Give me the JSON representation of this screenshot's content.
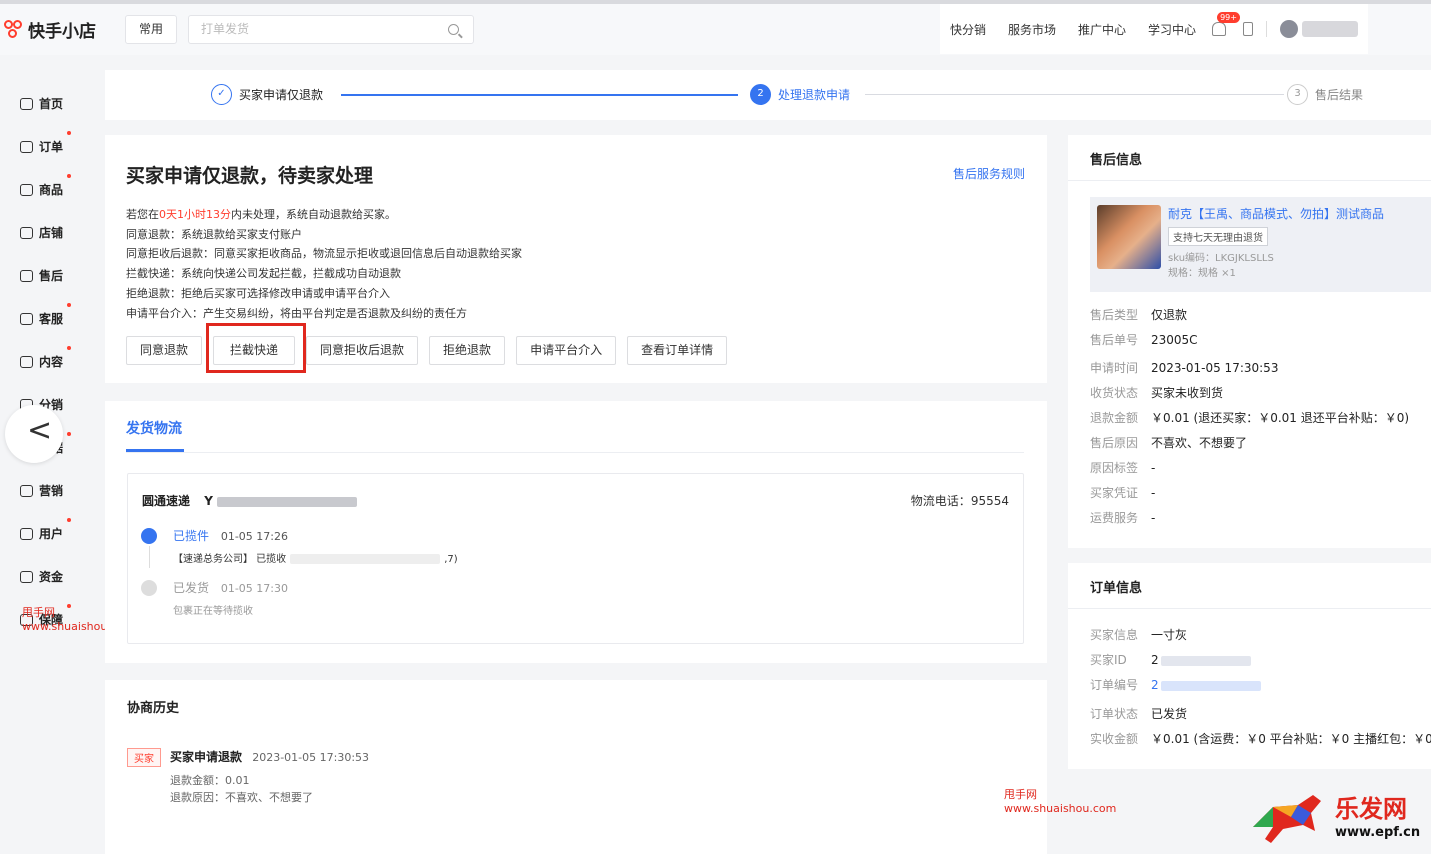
{
  "header": {
    "brand": "快手小店",
    "common_label": "常用",
    "search_placeholder": "打单发货",
    "nav": [
      "快分销",
      "服务市场",
      "推广中心",
      "学习中心"
    ],
    "notify_badge": "99+"
  },
  "sidebar": {
    "items": [
      {
        "label": "首页",
        "icon": "home-icon",
        "dot": false
      },
      {
        "label": "订单",
        "icon": "order-icon",
        "dot": true
      },
      {
        "label": "商品",
        "icon": "goods-icon",
        "dot": true
      },
      {
        "label": "店铺",
        "icon": "shop-icon",
        "dot": false
      },
      {
        "label": "售后",
        "icon": "aftersale-icon",
        "dot": false
      },
      {
        "label": "客服",
        "icon": "service-icon",
        "dot": true
      },
      {
        "label": "内容",
        "icon": "content-icon",
        "dot": true
      },
      {
        "label": "分销",
        "icon": "distribution-icon",
        "dot": false
      },
      {
        "label": "数据",
        "icon": "data-icon",
        "dot": true
      },
      {
        "label": "营销",
        "icon": "marketing-icon",
        "dot": false
      },
      {
        "label": "用户",
        "icon": "user-icon",
        "dot": true
      },
      {
        "label": "资金",
        "icon": "funds-icon",
        "dot": false
      },
      {
        "label": "保障",
        "icon": "shield-icon",
        "dot": true
      }
    ],
    "collapse_glyph": "<"
  },
  "watermark": {
    "name": "甩手网",
    "url": "www.shuaishou.com"
  },
  "steps": {
    "s1": "买家申请仅退款",
    "s2_num": "2",
    "s2": "处理退款申请",
    "s3_num": "3",
    "s3": "售后结果"
  },
  "main": {
    "title": "买家申请仅退款，待卖家处理",
    "rule_link": "售后服务规则",
    "countdown_prefix": "若您在",
    "countdown": "0天1小时13分",
    "countdown_suffix": "内未处理，系统自动退款给买家。",
    "lines": [
      "同意退款：系统退款给买家支付账户",
      "同意拒收后退款：同意买家拒收商品，物流显示拒收或退回信息后自动退款给买家",
      "拦截快递：系统向快递公司发起拦截，拦截成功自动退款",
      "拒绝退款：拒绝后买家可选择修改申请或申请平台介入",
      "申请平台介入：产生交易纠纷，将由平台判定是否退款及纠纷的责任方"
    ],
    "buttons": [
      "同意退款",
      "拦截快递",
      "同意拒收后退款",
      "拒绝退款",
      "申请平台介入",
      "查看订单详情"
    ]
  },
  "shipping": {
    "tab": "发货物流",
    "carrier": "圆通速递",
    "tracking_prefix": "Y",
    "phone_label": "物流电话：",
    "phone": "95554",
    "events": [
      {
        "status": "已揽件",
        "time": "01-05 17:26",
        "detail": "【速递总务公司】 已揽收",
        "detail_tail": ",7)"
      },
      {
        "status": "已发货",
        "time": "01-05 17:30",
        "detail": "包裹正在等待揽收",
        "detail_tail": ""
      }
    ]
  },
  "history": {
    "title": "协商历史",
    "tag": "买家",
    "action": "买家申请退款",
    "time": "2023-01-05 17:30:53",
    "amount": "退款金额：0.01",
    "reason": "退款原因：不喜欢、不想要了"
  },
  "aftersale": {
    "title": "售后信息",
    "product_name": "耐克【王禹、商品模式、勿拍】测试商品",
    "product_tag": "支持七天无理由退货",
    "sku": "sku编码：LKGJKLSLLS",
    "spec": "规格：规格 ×1",
    "rows": [
      {
        "k": "售后类型",
        "v": "仅退款"
      },
      {
        "k": "售后单号",
        "v": "23005C"
      },
      {
        "k": "申请时间",
        "v": "2023-01-05 17:30:53"
      },
      {
        "k": "收货状态",
        "v": "买家未收到货"
      },
      {
        "k": "退款金额",
        "v": "￥0.01  (退还买家：￥0.01 退还平台补贴：￥0)"
      },
      {
        "k": "售后原因",
        "v": "不喜欢、不想要了"
      },
      {
        "k": "原因标签",
        "v": "-"
      },
      {
        "k": "买家凭证",
        "v": "-"
      },
      {
        "k": "运费服务",
        "v": "-"
      }
    ]
  },
  "order": {
    "title": "订单信息",
    "rows": [
      {
        "k": "买家信息",
        "v": "一寸灰"
      },
      {
        "k": "买家ID",
        "v": "2"
      },
      {
        "k": "订单编号",
        "v": "2"
      },
      {
        "k": "订单状态",
        "v": "已发货"
      },
      {
        "k": "实收金额",
        "v": "￥0.01  (含运费：￥0 平台补贴：￥0 主播红包：￥0"
      }
    ]
  },
  "corner_logo": {
    "text": "乐发网",
    "url": "www.epf.cn"
  }
}
